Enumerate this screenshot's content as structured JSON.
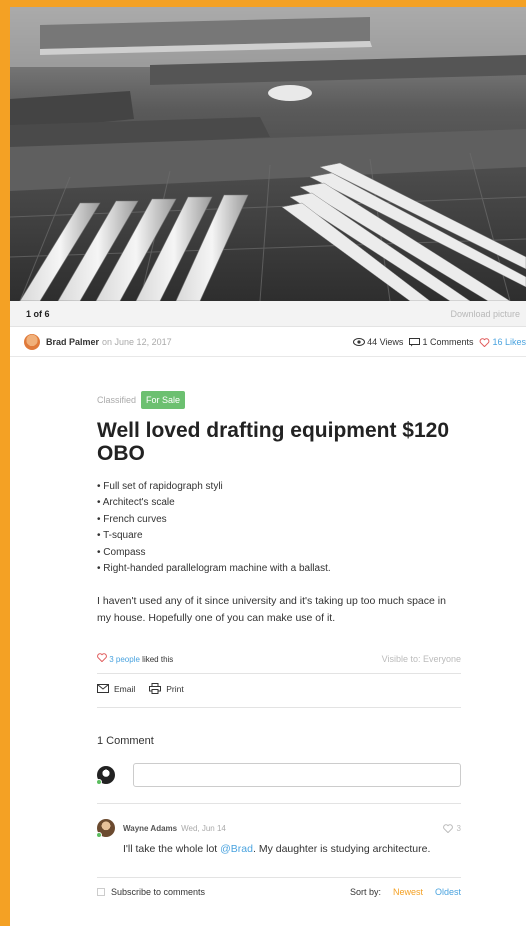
{
  "gallery": {
    "counter": "1 of 6",
    "download_label": "Download picture"
  },
  "post": {
    "author": "Brad Palmer",
    "date": "on June 12, 2017",
    "views": "44 Views",
    "comments_count": "1 Comments",
    "likes": "16 Likes",
    "category": "Classified",
    "tag": "For Sale",
    "title": "Well loved drafting equipment $120 OBO",
    "bullets": [
      "• Full set of rapidograph styli",
      "• Architect's scale",
      "• French curves",
      "• T-square",
      "• Compass",
      "• Right-handed parallelogram machine with a ballast."
    ],
    "body": "I haven't used any of it since university and it's taking up too much space in my house. Hopefully one of you can make use of it.",
    "liked_people": "3 people",
    "liked_suffix": "liked this",
    "visibility": "Visible to: Everyone",
    "email_label": "Email",
    "print_label": "Print"
  },
  "comments": {
    "title": "1 Comment",
    "items": [
      {
        "author": "Wayne Adams",
        "date": "Wed, Jun 14",
        "likes": "3",
        "text_before": "I'll take the whole lot ",
        "mention": "@Brad",
        "text_after": ". My daughter is studying architecture."
      }
    ],
    "subscribe_label": "Subscribe to comments",
    "sort_label": "Sort by:",
    "sort_newest": "Newest",
    "sort_oldest": "Oldest"
  },
  "colors": {
    "accent": "#f4a124",
    "link": "#4aa3df",
    "tag_green": "#6cc070",
    "heart": "#e05a5a"
  }
}
